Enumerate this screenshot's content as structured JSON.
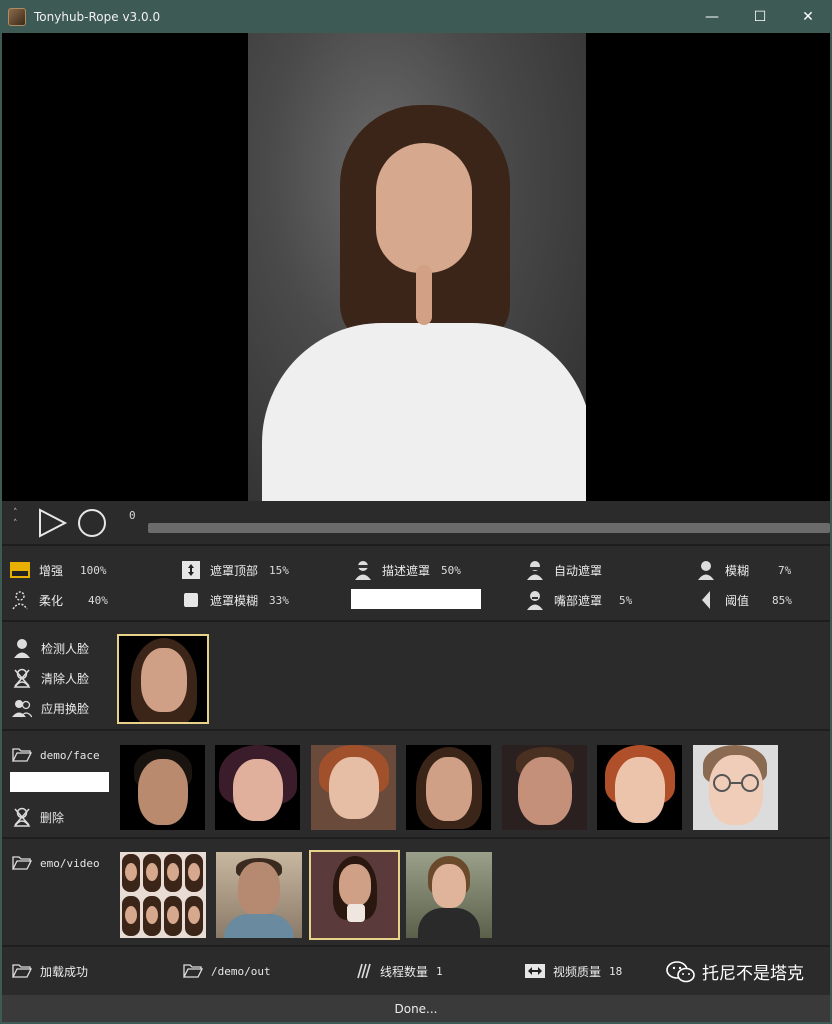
{
  "window": {
    "title": "Tonyhub-Rope v3.0.0",
    "minimize_glyph": "—",
    "maximize_glyph": "☐",
    "close_glyph": "✕"
  },
  "player": {
    "carets": [
      "˄",
      "˄"
    ],
    "frame_number": "0",
    "timeline_progress": 0.0
  },
  "params": {
    "enhance": {
      "label": "增强",
      "value": "100%"
    },
    "soften": {
      "label": "柔化",
      "value": "40%"
    },
    "mask_top": {
      "label": "遮罩顶部",
      "value": "15%"
    },
    "mask_blur": {
      "label": "遮罩模糊",
      "value": "33%"
    },
    "describe_mask": {
      "label": "描述遮罩",
      "value": "50%"
    },
    "auto_mask": {
      "label": "自动遮罩"
    },
    "mouth_mask": {
      "label": "嘴部遮罩",
      "value": "5%"
    },
    "blur": {
      "label": "模糊",
      "value": "7%"
    },
    "threshold": {
      "label": "阈值",
      "value": "85%"
    }
  },
  "source": {
    "detect_faces": "检测人脸",
    "clear_faces": "清除人脸",
    "apply_swap": "应用换脸"
  },
  "faces": {
    "folder": "demo/face",
    "delete": "删除"
  },
  "videos": {
    "folder": "emo/video"
  },
  "bottom": {
    "load_status": "加载成功",
    "output_path": "/demo/out",
    "threads_label": "线程数量",
    "threads_value": "1",
    "quality_label": "视频质量",
    "quality_value": "18",
    "watermark": "托尼不是塔克"
  },
  "status": "Done...",
  "colors": {
    "titlebar": "#3e5a55",
    "panel": "#2b2b2b",
    "selection": "#e8d28a"
  }
}
